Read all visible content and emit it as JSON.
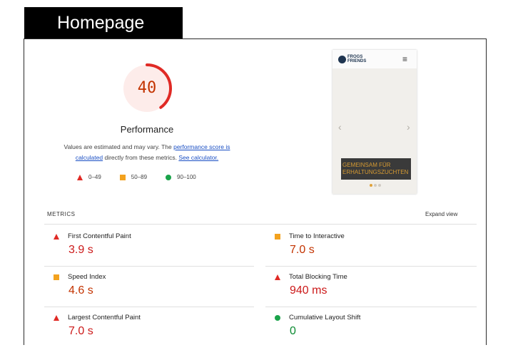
{
  "tag": "Homepage",
  "score": {
    "value": "40",
    "fraction": 0.4,
    "title": "Performance",
    "note_prefix": "Values are estimated and may vary. The ",
    "note_link1": "performance score is calculated",
    "note_middle": " directly from these metrics. ",
    "note_link2": "See calculator."
  },
  "legend": [
    {
      "shape": "triangle",
      "range": "0–49",
      "color": "#e02a25"
    },
    {
      "shape": "square",
      "range": "50–89",
      "color": "#f3a21e"
    },
    {
      "shape": "circle",
      "range": "90–100",
      "color": "#1aa34a"
    }
  ],
  "screenshot": {
    "logo": "FROGS\nFRIENDS",
    "prev_arrow": "‹",
    "next_arrow": "›",
    "banner": "GEMEINSAM FÜR ERHALTUNGSZUCHTEN"
  },
  "metrics_header": "METRICS",
  "expand_view": "Expand view",
  "metrics": [
    {
      "label": "First Contentful Paint",
      "value": "3.9 s",
      "status": "red"
    },
    {
      "label": "Time to Interactive",
      "value": "7.0 s",
      "status": "orange"
    },
    {
      "label": "Speed Index",
      "value": "4.6 s",
      "status": "orange"
    },
    {
      "label": "Total Blocking Time",
      "value": "940 ms",
      "status": "red"
    },
    {
      "label": "Largest Contentful Paint",
      "value": "7.0 s",
      "status": "red"
    },
    {
      "label": "Cumulative Layout Shift",
      "value": "0",
      "status": "green"
    }
  ],
  "colors": {
    "red": "#e02a25",
    "orange": "#f3a21e",
    "green": "#1aa34a",
    "gauge_bg": "#fdecea"
  }
}
